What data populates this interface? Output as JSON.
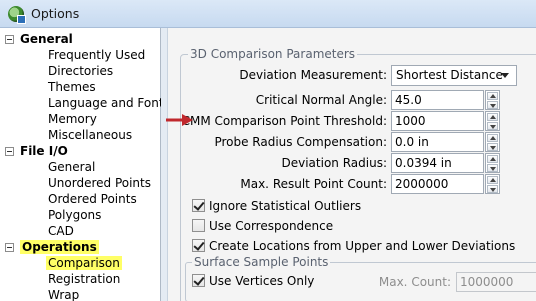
{
  "window": {
    "title": "Options"
  },
  "tree": {
    "groups": [
      {
        "label": "General",
        "items": [
          "Frequently Used",
          "Directories",
          "Themes",
          "Language and Fonts",
          "Memory",
          "Miscellaneous"
        ]
      },
      {
        "label": "File I/O",
        "items": [
          "General",
          "Unordered Points",
          "Ordered Points",
          "Polygons",
          "CAD"
        ]
      },
      {
        "label": "Operations",
        "items": [
          "Comparison",
          "Registration",
          "Wrap"
        ]
      }
    ]
  },
  "comparison": {
    "group_title": "3D Comparison Parameters",
    "deviation_measurement": {
      "label": "Deviation Measurement:",
      "value": "Shortest Distance"
    },
    "critical_normal_angle": {
      "label": "Critical Normal Angle:",
      "value": "45.0"
    },
    "cmm_threshold": {
      "label": "CMM Comparison Point Threshold:",
      "value": "1000"
    },
    "probe_radius": {
      "label": "Probe Radius Compensation:",
      "value": "0.0 in"
    },
    "deviation_radius": {
      "label": "Deviation Radius:",
      "value": "0.0394 in"
    },
    "max_result": {
      "label": "Max. Result Point Count:",
      "value": "2000000"
    },
    "checkboxes": {
      "ignore_outliers": "Ignore Statistical Outliers",
      "use_correspondence": "Use Correspondence",
      "create_locations": "Create Locations from Upper and Lower Deviations"
    },
    "surface_sample": {
      "title": "Surface Sample Points",
      "use_vertices": "Use Vertices Only",
      "max_count_label": "Max. Count:",
      "max_count_value": "1000000"
    }
  },
  "colors": {
    "annotation_arrow": "#c0282d",
    "highlight": "#ffff66"
  }
}
